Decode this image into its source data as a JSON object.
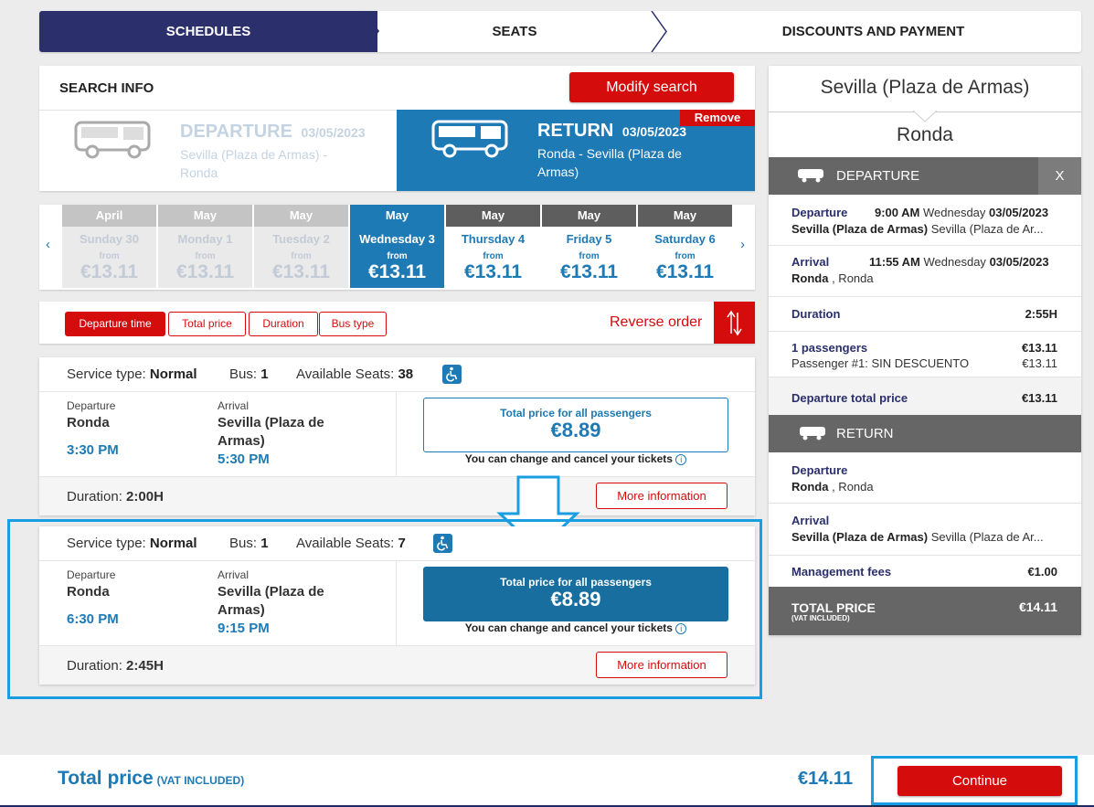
{
  "steps": [
    "SCHEDULES",
    "SEATS",
    "DISCOUNTS AND PAYMENT"
  ],
  "search": {
    "title": "SEARCH INFO",
    "modify_label": "Modify search",
    "departure": {
      "label": "DEPARTURE",
      "date": "03/05/2023",
      "route": "Sevilla (Plaza de Armas) - Ronda"
    },
    "return": {
      "label": "RETURN",
      "date": "03/05/2023",
      "route": "Ronda - Sevilla (Plaza de Armas)",
      "remove_label": "Remove"
    }
  },
  "dates": [
    {
      "month": "April",
      "day": "Sunday 30",
      "from": "from",
      "price": "€13.11",
      "state": "past"
    },
    {
      "month": "May",
      "day": "Monday 1",
      "from": "from",
      "price": "€13.11",
      "state": "past"
    },
    {
      "month": "May",
      "day": "Tuesday 2",
      "from": "from",
      "price": "€13.11",
      "state": "past"
    },
    {
      "month": "May",
      "day": "Wednesday 3",
      "from": "from",
      "price": "€13.11",
      "state": "active"
    },
    {
      "month": "May",
      "day": "Thursday 4",
      "from": "from",
      "price": "€13.11",
      "state": "future"
    },
    {
      "month": "May",
      "day": "Friday 5",
      "from": "from",
      "price": "€13.11",
      "state": "future"
    },
    {
      "month": "May",
      "day": "Saturday 6",
      "from": "from",
      "price": "€13.11",
      "state": "future"
    }
  ],
  "date_nav": {
    "prev": "‹",
    "next": "›"
  },
  "sort": {
    "options": [
      "Departure time",
      "Total price",
      "Duration",
      "Bus type"
    ],
    "active": "Departure time",
    "reverse_label": "Reverse order"
  },
  "trips": [
    {
      "service_label": "Service type:",
      "service_value": "Normal",
      "bus_label": "Bus:",
      "bus_value": "1",
      "seats_label": "Available Seats:",
      "seats_value": "38",
      "dep_label": "Departure",
      "dep_city": "Ronda",
      "dep_time": "3:30 PM",
      "arr_label": "Arrival",
      "arr_city": "Sevilla (Plaza de Armas)",
      "arr_time": "5:30 PM",
      "price_label": "Total price for all passengers",
      "price": "€8.89",
      "change_note": "You can change and cancel your tickets",
      "duration_label": "Duration:",
      "duration_value": "2:00H",
      "more_label": "More information",
      "selected": false
    },
    {
      "service_label": "Service type:",
      "service_value": "Normal",
      "bus_label": "Bus:",
      "bus_value": "1",
      "seats_label": "Available Seats:",
      "seats_value": "7",
      "dep_label": "Departure",
      "dep_city": "Ronda",
      "dep_time": "6:30 PM",
      "arr_label": "Arrival",
      "arr_city": "Sevilla (Plaza de Armas)",
      "arr_time": "9:15 PM",
      "price_label": "Total price for all passengers",
      "price": "€8.89",
      "change_note": "You can change and cancel your tickets",
      "duration_label": "Duration:",
      "duration_value": "2:45H",
      "more_label": "More information",
      "selected": true
    }
  ],
  "sidebar": {
    "origin": "Sevilla (Plaza de Armas)",
    "destination": "Ronda",
    "departure_header": "DEPARTURE",
    "close_label": "X",
    "dep": {
      "departure_label": "Departure",
      "departure_time": "9:00 AM",
      "departure_day": "Wednesday",
      "departure_date": "03/05/2023",
      "departure_station": "Sevilla (Plaza de Armas)",
      "departure_city": "Sevilla (Plaza de Ar...",
      "arrival_label": "Arrival",
      "arrival_time": "11:55 AM",
      "arrival_day": "Wednesday",
      "arrival_date": "03/05/2023",
      "arrival_station": "Ronda",
      "arrival_city": ", Ronda",
      "duration_label": "Duration",
      "duration_value": "2:55H",
      "passengers_label": "1 passengers",
      "passengers_price": "€13.11",
      "passenger1_label": "Passenger #1: SIN DESCUENTO",
      "passenger1_price": "€13.11",
      "total_label": "Departure total price",
      "total_value": "€13.11"
    },
    "return_header": "RETURN",
    "ret": {
      "departure_label": "Departure",
      "departure_station": "Ronda",
      "departure_city": ", Ronda",
      "arrival_label": "Arrival",
      "arrival_station": "Sevilla (Plaza de Armas)",
      "arrival_city": "Sevilla (Plaza de Ar..."
    },
    "fees_label": "Management fees",
    "fees_value": "€1.00",
    "total_label": "TOTAL PRICE",
    "total_vat": "(VAT INCLUDED)",
    "total_value": "€14.11"
  },
  "footer": {
    "total_label": "Total price",
    "vat_label": "(VAT INCLUDED)",
    "total_value": "€14.11",
    "continue_label": "Continue"
  },
  "colors": {
    "primary": "#1d7ab5",
    "brand_dark": "#2b2f6c",
    "accent": "#d40c0c",
    "highlight": "#1a9ee2"
  }
}
